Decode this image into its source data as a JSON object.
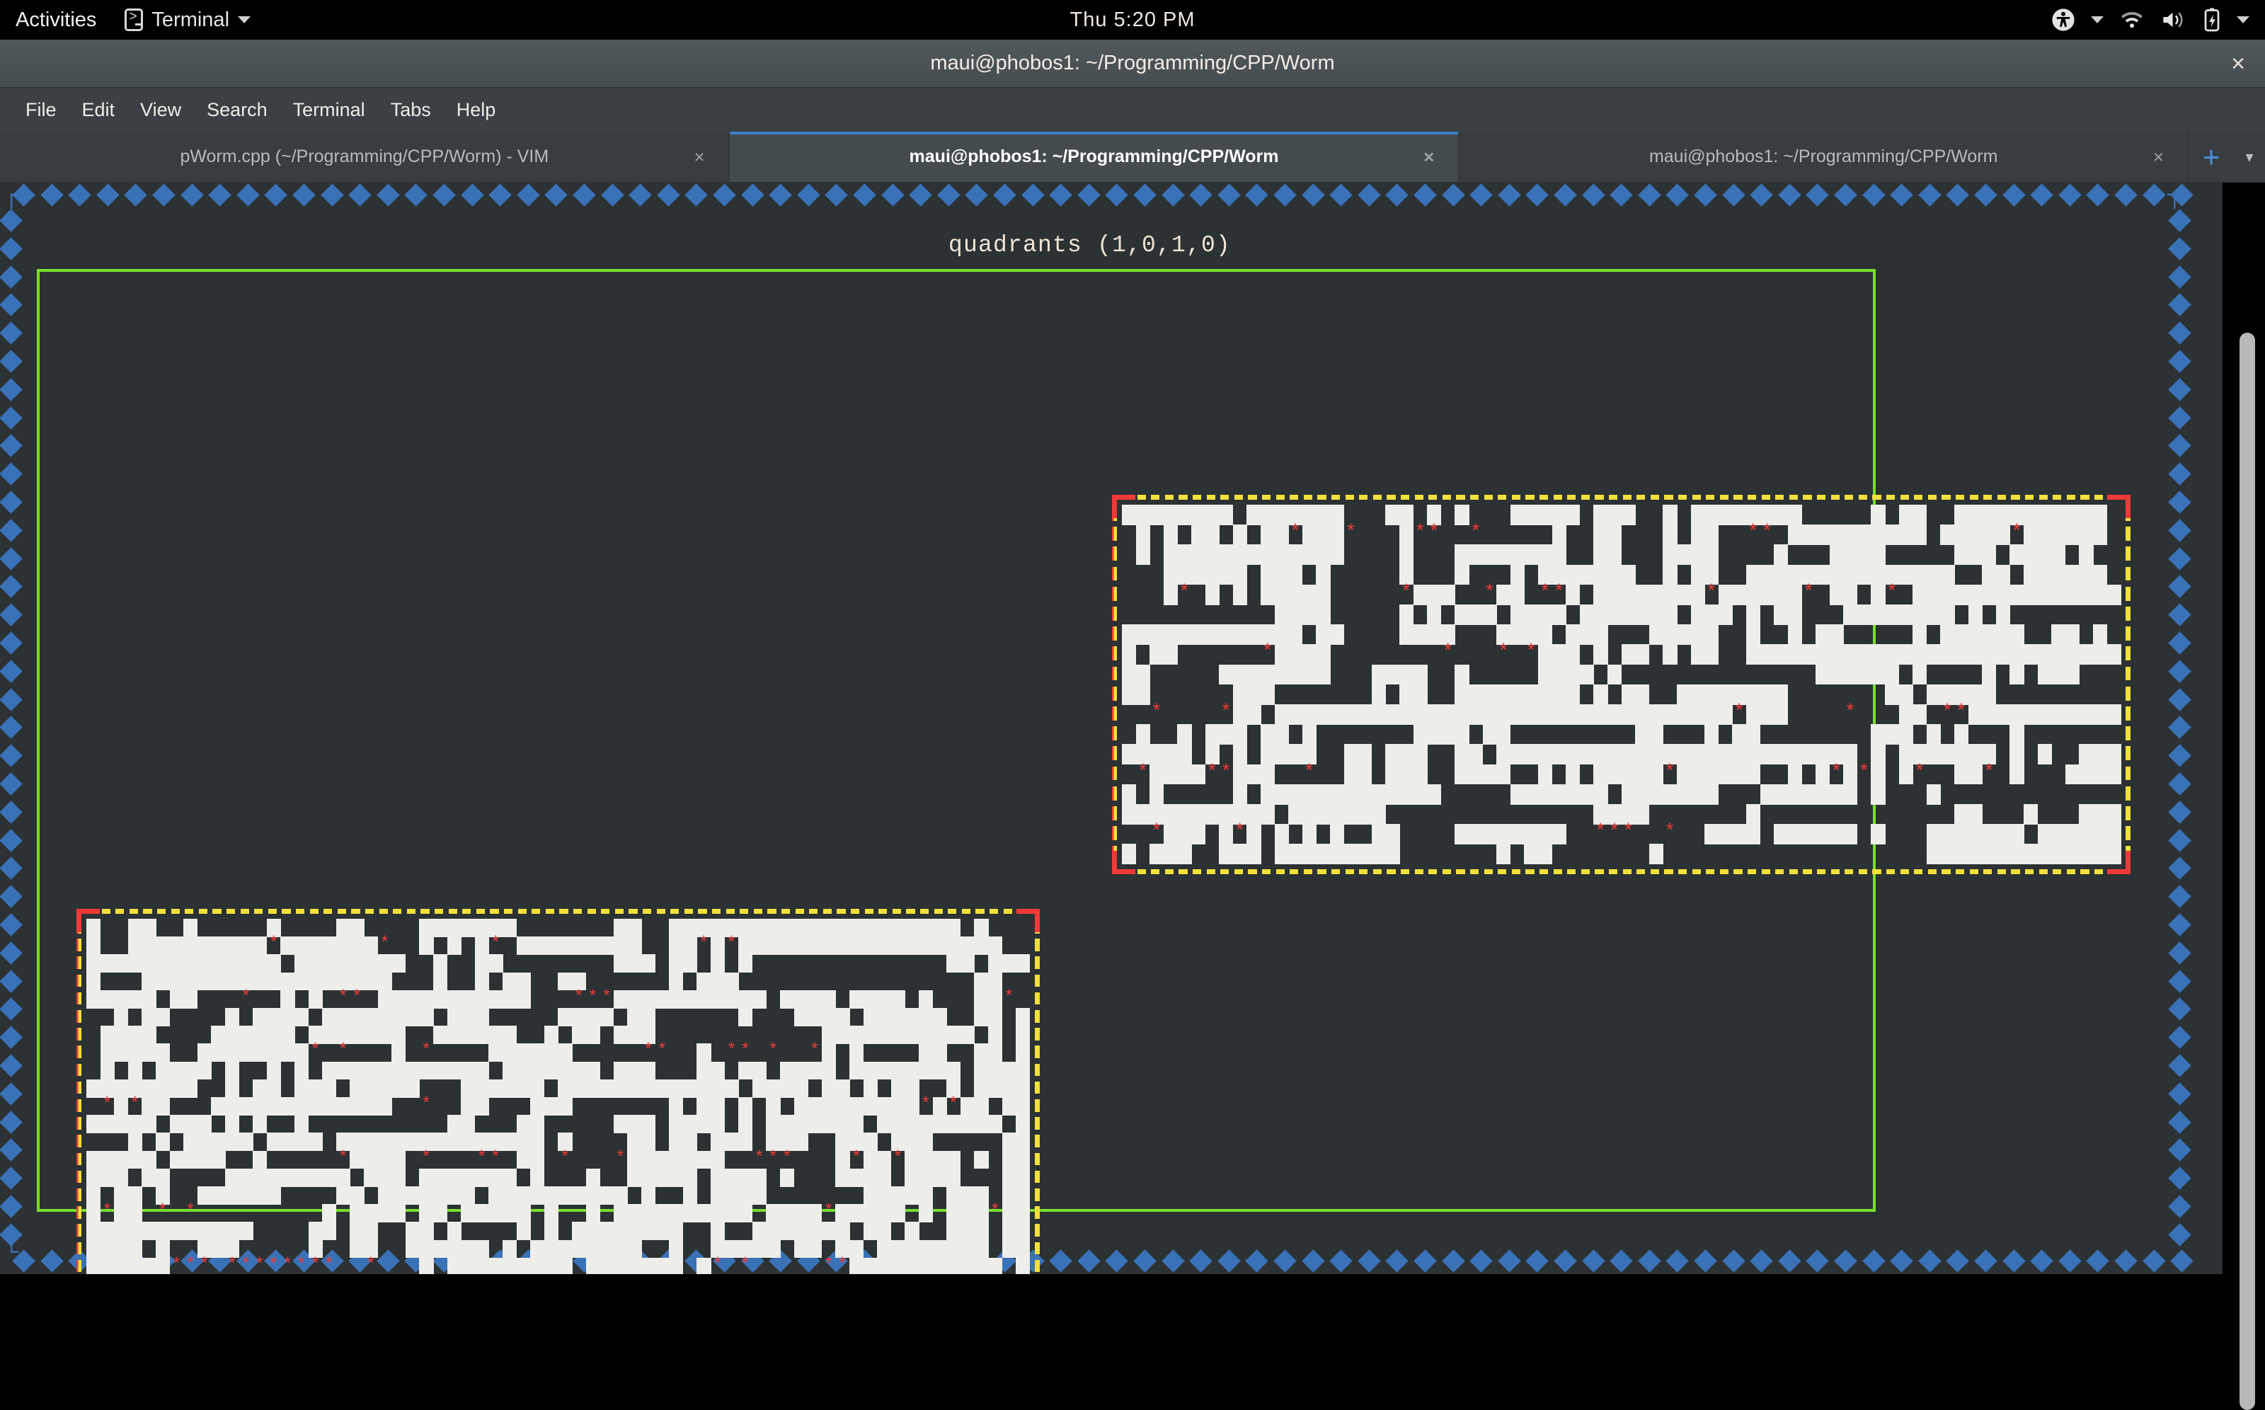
{
  "topbar": {
    "activities": "Activities",
    "app_name": "Terminal",
    "app_icon": "terminal-icon",
    "clock": "Thu  5:20 PM",
    "tray_icons": [
      "accessibility-icon",
      "chevron-down-icon",
      "wifi-icon",
      "volume-icon",
      "battery-charging-icon",
      "chevron-down-icon"
    ]
  },
  "window": {
    "title": "maui@phobos1: ~/Programming/CPP/Worm",
    "close_label": "×"
  },
  "menubar": {
    "items": [
      "File",
      "Edit",
      "View",
      "Search",
      "Terminal",
      "Tabs",
      "Help"
    ]
  },
  "tabs": {
    "items": [
      {
        "label": "pWorm.cpp (~/Programming/CPP/Worm) - VIM",
        "active": false,
        "close": "×"
      },
      {
        "label": "maui@phobos1: ~/Programming/CPP/Worm",
        "active": true,
        "close": "×"
      },
      {
        "label": "maui@phobos1: ~/Programming/CPP/Worm",
        "active": false,
        "close": "×"
      }
    ],
    "new_tab_label": "+",
    "tab_menu_label": "▾"
  },
  "terminal": {
    "status_line": "quadrants (1,0,1,0)",
    "border_glyph": "◆",
    "corner_top_left": "┌",
    "corner_top_right": "┐",
    "corner_bottom_left": "└",
    "item_glyph": "*",
    "colors": {
      "background": "#2c3133",
      "border_blue": "#3a72b8",
      "frame_green": "#77e02c",
      "maze_wall": "#ededea",
      "maze_border_yellow": "#f2e03c",
      "maze_corner_red": "#ef3a37",
      "item_red": "#ef3a37",
      "text": "#efe4d4"
    },
    "quadrants": {
      "values": [
        1,
        0,
        1,
        0
      ],
      "visible_regions": [
        "top-right",
        "bottom-left"
      ]
    },
    "mazes": [
      {
        "name": "top-right-maze",
        "cols": 72,
        "rows": 18,
        "items": 41
      },
      {
        "name": "bottom-left-maze",
        "cols": 68,
        "rows": 22,
        "items": 58
      }
    ]
  },
  "scrollbar": {
    "name": "terminal-scrollbar",
    "position": "right"
  }
}
